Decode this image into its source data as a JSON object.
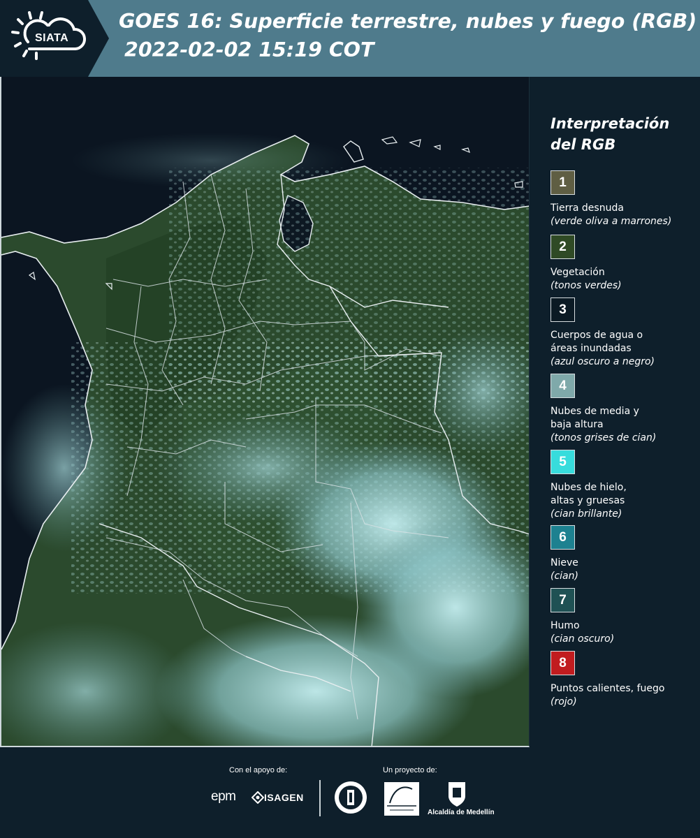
{
  "header": {
    "logo_text": "SIATA",
    "title_line1": "GOES 16: Superficie terrestre, nubes y fuego (RGB)",
    "title_line2": "2022-02-02 15:19 COT"
  },
  "legend": {
    "title": "Interpretación del RGB",
    "items": [
      {
        "number": "1",
        "label": "Tierra desnuda",
        "desc": "(verde oliva a marrones)",
        "color": "#5f5e43"
      },
      {
        "number": "2",
        "label": "Vegetación",
        "desc": "(tonos verdes)",
        "color": "#2f4a25"
      },
      {
        "number": "3",
        "label": "Cuerpos de agua o áreas inundadas",
        "desc": "(azul oscuro a negro)",
        "color": "#0b1a24"
      },
      {
        "number": "4",
        "label": "Nubes de media y baja altura",
        "desc": "(tonos grises de cian)",
        "color": "#7fa9aa"
      },
      {
        "number": "5",
        "label": "Nubes de hielo, altas y gruesas",
        "desc": "(cian brillante)",
        "color": "#37dcdc"
      },
      {
        "number": "6",
        "label": "Nieve",
        "desc": "(cian)",
        "color": "#1d8190"
      },
      {
        "number": "7",
        "label": "Humo",
        "desc": "(cian oscuro)",
        "color": "#1f5154"
      },
      {
        "number": "8",
        "label": "Puntos calientes, fuego",
        "desc": "(rojo)",
        "color": "#c11c1f"
      }
    ]
  },
  "footer": {
    "support_label": "Con el apoyo de:",
    "project_label": "Un proyecto de:",
    "sponsors": [
      "epm",
      "ISAGEN"
    ],
    "partners": [
      "Área Metropolitana",
      "Alcaldía de Medellín"
    ],
    "alcaldia_label": "Alcaldía de Medellín"
  },
  "colors": {
    "background": "#0e1f2b",
    "header_bar": "#4f7b8c",
    "ocean": "#0b1420",
    "vegetation": "#2c4a2c",
    "cloud": "#9fd6d8"
  }
}
